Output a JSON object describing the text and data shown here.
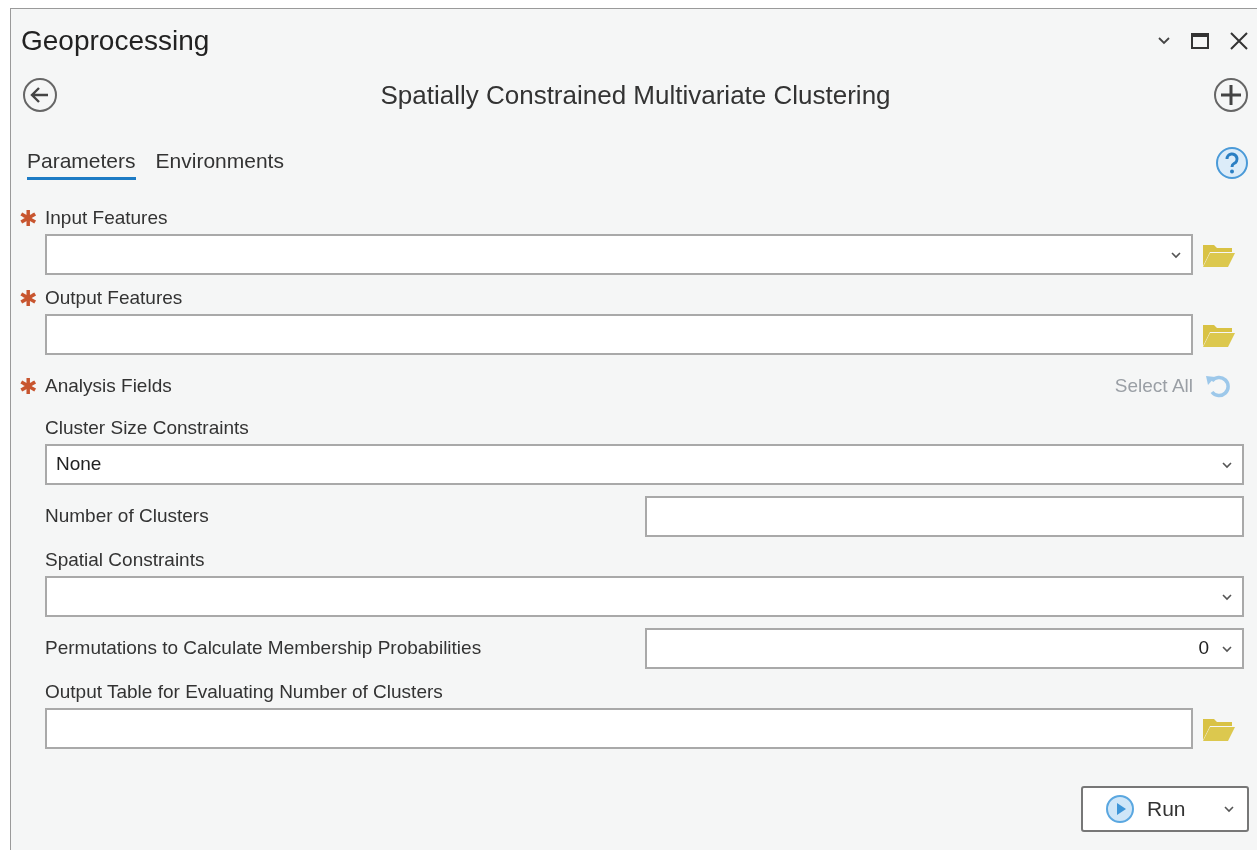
{
  "window": {
    "title": "Geoprocessing"
  },
  "tool": {
    "title": "Spatially Constrained Multivariate Clustering"
  },
  "tabs": [
    {
      "label": "Parameters",
      "selected": true
    },
    {
      "label": "Environments",
      "selected": false
    }
  ],
  "parameters": [
    {
      "kind": "stacked",
      "label": "Input Features",
      "required_mark": "✱",
      "dropdown": true,
      "browse": true
    },
    {
      "kind": "stacked",
      "label": "Output Features",
      "required_mark": "✱",
      "dropdown": false,
      "browse": true
    },
    {
      "kind": "field_list",
      "label": "Analysis Fields",
      "required_mark": "✱",
      "action": {
        "label": "Select All",
        "disabled": true
      }
    },
    {
      "kind": "stacked",
      "label": "Cluster Size Constraints",
      "dropdown": true,
      "browse": false,
      "value": "None"
    },
    {
      "kind": "inline",
      "label": "Number of Clusters",
      "dropdown": false
    },
    {
      "kind": "stacked",
      "label": "Spatial Constraints",
      "dropdown": true,
      "browse": false
    },
    {
      "kind": "inline",
      "label": "Permutations to Calculate Membership Probabilities",
      "dropdown": true,
      "value": "0"
    },
    {
      "kind": "stacked",
      "label": "Output Table for Evaluating Number of Clusters",
      "dropdown": false,
      "browse": true
    }
  ],
  "run_button": {
    "label": "Run"
  }
}
